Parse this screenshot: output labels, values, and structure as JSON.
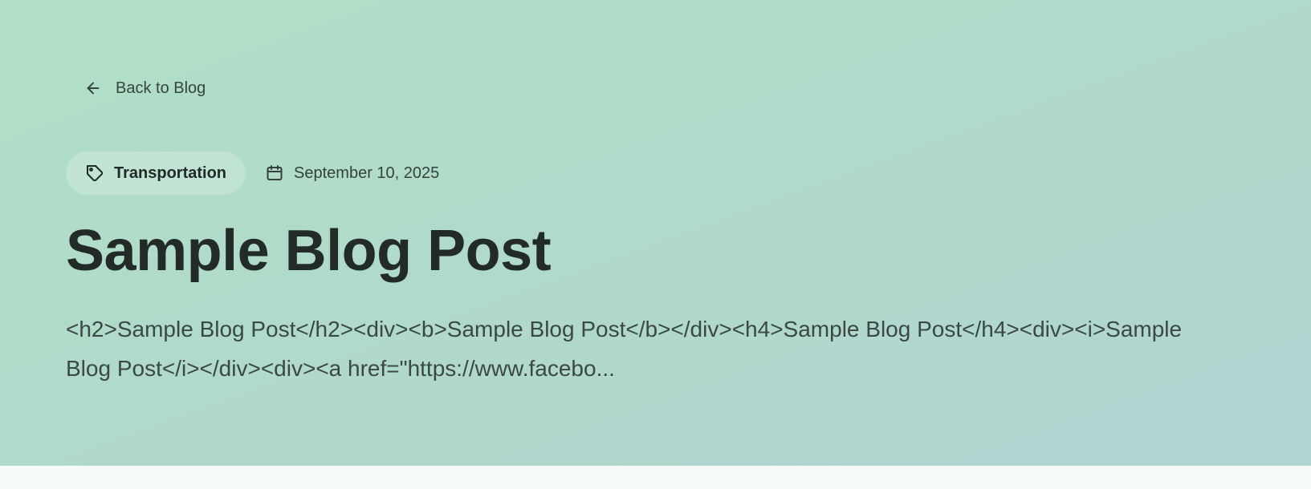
{
  "hero": {
    "back_label": "Back to Blog",
    "category": "Transportation",
    "date": "September 10, 2025",
    "title": "Sample Blog Post",
    "excerpt": "<h2>Sample Blog Post</h2><div><b>Sample Blog Post</b></div><h4>Sample Blog Post</h4><div><i>Sample Blog Post</i></div><div><a href=\"https://www.facebo..."
  },
  "icons": {
    "back": "arrow-left-icon",
    "category": "tag-icon",
    "date": "calendar-icon"
  },
  "colors": {
    "hero_gradient_start": "#b0dfc5",
    "hero_gradient_end": "#b0d5d3",
    "title": "#232b29",
    "body_text": "#3b4845",
    "page_background": "#f7fbf7"
  }
}
